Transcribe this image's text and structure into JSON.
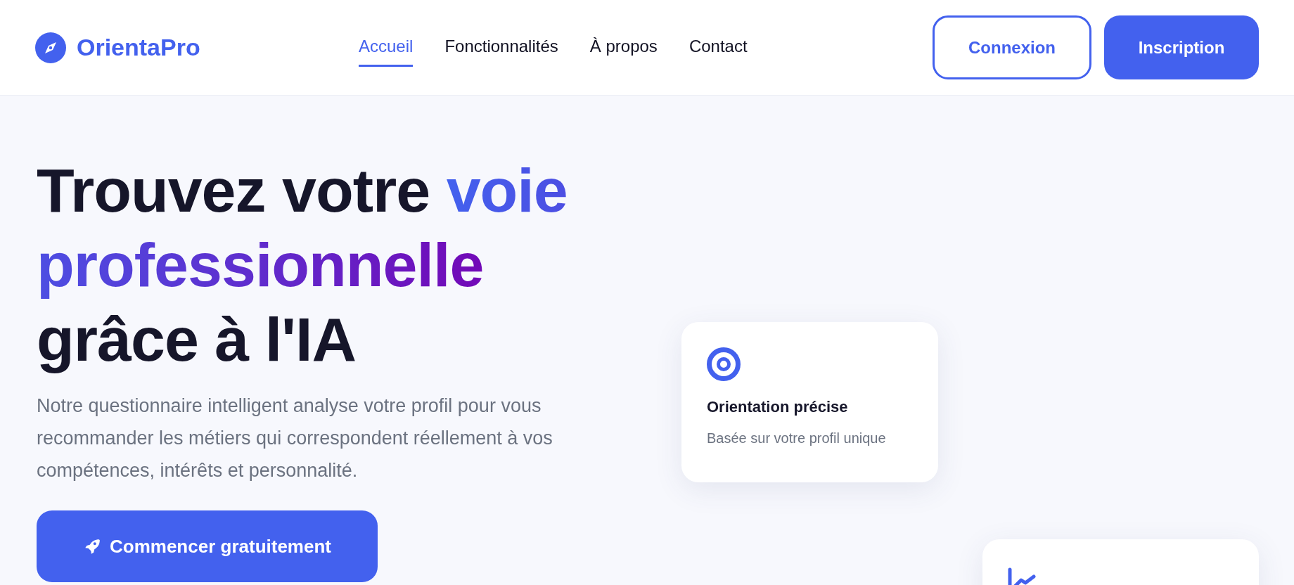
{
  "brand": "OrientaPro",
  "nav": [
    {
      "label": "Accueil",
      "selected": true
    },
    {
      "label": "Fonctionnalités",
      "selected": false
    },
    {
      "label": "À propos",
      "selected": false
    },
    {
      "label": "Contact",
      "selected": false
    }
  ],
  "auth_buttons": [
    {
      "label": "Connexion",
      "kind": "outline"
    },
    {
      "label": "Inscription",
      "kind": "primary"
    }
  ],
  "hero": {
    "title": [
      {
        "text": "Trouvez votre ",
        "kind": "plain"
      },
      {
        "text": "voie professionnelle",
        "kind": "gradient"
      },
      {
        "text": "grâce à l'IA",
        "kind": "plain"
      }
    ],
    "description": "Notre questionnaire intelligent analyse votre profil pour vous recommander les métiers qui correspondent réellement à vos compétences, intérêts et personnalité.",
    "cta": "Commencer gratuitement"
  },
  "feature_card": {
    "title": "Orientation précise",
    "description": "Basée sur votre profil unique"
  }
}
